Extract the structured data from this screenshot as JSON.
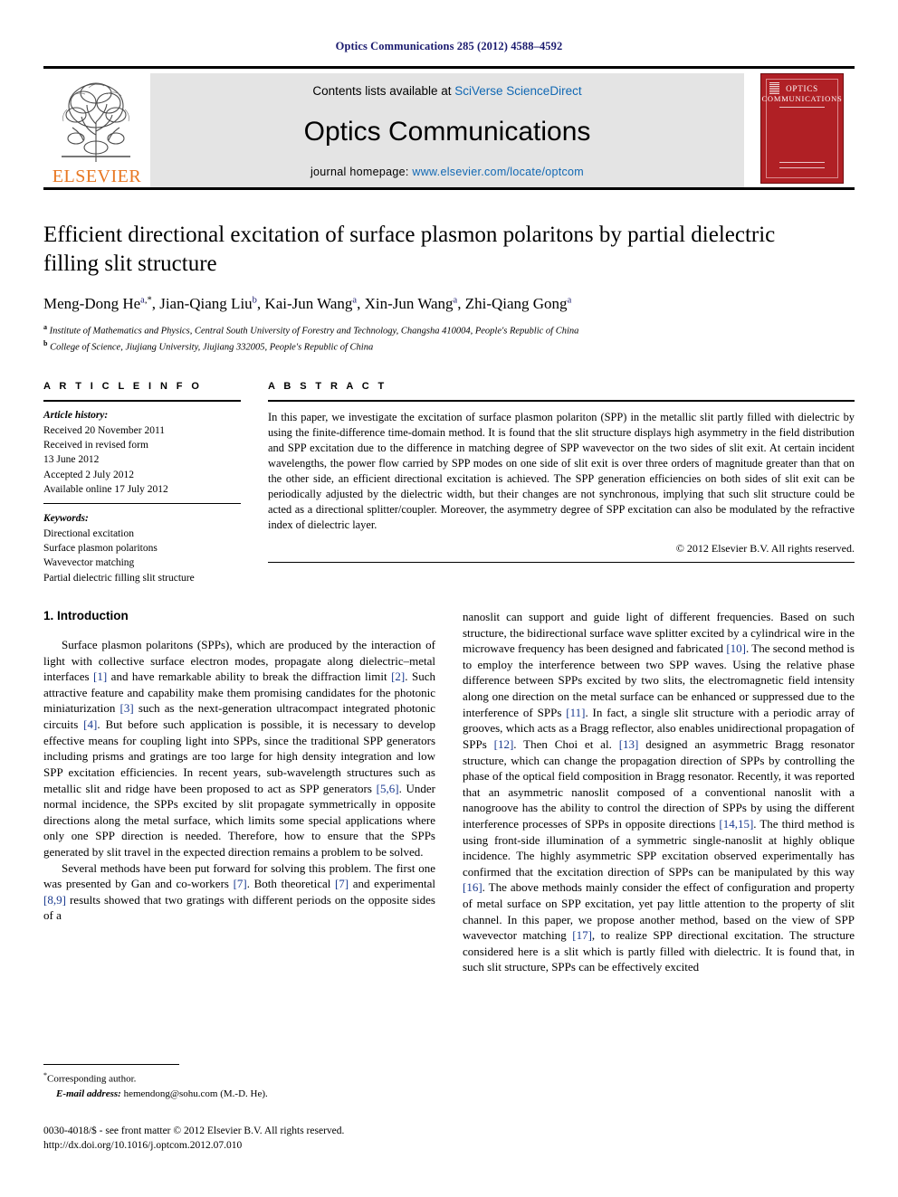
{
  "running_head": "Optics Communications 285 (2012) 4588–4592",
  "banner": {
    "contents_prefix": "Contents lists available at ",
    "contents_link": "SciVerse ScienceDirect",
    "journal_title": "Optics Communications",
    "homepage_prefix": "journal homepage: ",
    "homepage_link": "www.elsevier.com/locate/optcom",
    "publisher_name": "ELSEVIER",
    "cover": {
      "line1": "OPTICS",
      "line2": "COMMUNICATIONS"
    }
  },
  "title": "Efficient directional excitation of surface plasmon polaritons by partial dielectric filling slit structure",
  "authors": [
    {
      "name": "Meng-Dong He",
      "sup": "a",
      "star": true
    },
    {
      "name": "Jian-Qiang Liu",
      "sup": "b",
      "star": false
    },
    {
      "name": "Kai-Jun Wang",
      "sup": "a",
      "star": false
    },
    {
      "name": "Xin-Jun Wang",
      "sup": "a",
      "star": false
    },
    {
      "name": "Zhi-Qiang Gong",
      "sup": "a",
      "star": false
    }
  ],
  "affiliations": [
    {
      "marker": "a",
      "text": "Institute of Mathematics and Physics, Central South University of Forestry and Technology, Changsha 410004, People's Republic of China"
    },
    {
      "marker": "b",
      "text": "College of Science, Jiujiang University, Jiujiang 332005, People's Republic of China"
    }
  ],
  "article_info": {
    "heading": "A R T I C L E   I N F O",
    "history_label": "Article history:",
    "history": [
      "Received 20 November 2011",
      "Received in revised form",
      "13 June 2012",
      "Accepted 2 July 2012",
      "Available online 17 July 2012"
    ],
    "keywords_label": "Keywords:",
    "keywords": [
      "Directional excitation",
      "Surface plasmon polaritons",
      "Wavevector matching",
      "Partial dielectric filling slit structure"
    ]
  },
  "abstract": {
    "heading": "A B S T R A C T",
    "text": "In this paper, we investigate the excitation of surface plasmon polariton (SPP) in the metallic slit partly filled with dielectric by using the finite-difference time-domain method. It is found that the slit structure displays high asymmetry in the field distribution and SPP excitation due to the difference in matching degree of SPP wavevector on the two sides of slit exit. At certain incident wavelengths, the power flow carried by SPP modes on one side of slit exit is over three orders of magnitude greater than that on the other side, an efficient directional excitation is achieved. The SPP generation efficiencies on both sides of slit exit can be periodically adjusted by the dielectric width, but their changes are not synchronous, implying that such slit structure could be acted as a directional splitter/coupler. Moreover, the asymmetry degree of SPP excitation can also be modulated by the refractive index of dielectric layer.",
    "copyright": "© 2012 Elsevier B.V. All rights reserved."
  },
  "body": {
    "section_title": "1.  Introduction",
    "left_paragraphs": [
      "Surface plasmon polaritons (SPPs), which are produced by the interaction of light with collective surface electron modes, propagate along dielectric–metal interfaces [1] and have remarkable ability to break the diffraction limit [2]. Such attractive feature and capability make them promising candidates for the photonic miniaturization [3] such as the next-generation ultracompact integrated photonic circuits [4]. But before such application is possible, it is necessary to develop effective means for coupling light into SPPs, since the traditional SPP generators including prisms and gratings are too large for high density integration and low SPP excitation efficiencies. In recent years, sub-wavelength structures such as metallic slit and ridge have been proposed to act as SPP generators [5,6]. Under normal incidence, the SPPs excited by slit propagate symmetrically in opposite directions along the metal surface, which limits some special applications where only one SPP direction is needed. Therefore, how to ensure that the SPPs generated by slit travel in the expected direction remains a problem to be solved.",
      "Several methods have been put forward for solving this problem. The first one was presented by Gan and co-workers [7]. Both theoretical [7] and experimental [8,9] results showed that two gratings with different periods on the opposite sides of a"
    ],
    "right_paragraphs": [
      "nanoslit can support and guide light of different frequencies. Based on such structure, the bidirectional surface wave splitter excited by a cylindrical wire in the microwave frequency has been designed and fabricated [10]. The second method is to employ the interference between two SPP waves. Using the relative phase difference between SPPs excited by two slits, the electromagnetic field intensity along one direction on the metal surface can be enhanced or suppressed due to the interference of SPPs [11]. In fact, a single slit structure with a periodic array of grooves, which acts as a Bragg reflector, also enables unidirectional propagation of SPPs [12]. Then Choi et al. [13] designed an asymmetric Bragg resonator structure, which can change the propagation direction of SPPs by controlling the phase of the optical field composition in Bragg resonator. Recently, it was reported that an asymmetric nanoslit composed of a conventional nanoslit with a nanogroove has the ability to control the direction of SPPs by using the different interference processes of SPPs in opposite directions [14,15]. The third method is using front-side illumination of a symmetric single-nanoslit at highly oblique incidence. The highly asymmetric SPP excitation observed experimentally has confirmed that the excitation direction of SPPs can be manipulated by this way [16]. The above methods mainly consider the effect of configuration and property of metal surface on SPP excitation, yet pay little attention to the property of slit channel. In this paper, we propose another method, based on the view of SPP wavevector matching [17], to realize SPP directional excitation. The structure considered here is a slit which is partly filled with dielectric. It is found that, in such slit structure, SPPs can be effectively excited"
    ]
  },
  "footnotes": {
    "corresponding": "Corresponding author.",
    "email_label": "E-mail address:",
    "email": "hemendong@sohu.com (M.-D. He)."
  },
  "footer": {
    "issn_line": "0030-4018/$ - see front matter © 2012 Elsevier B.V. All rights reserved.",
    "doi_line": "http://dx.doi.org/10.1016/j.optcom.2012.07.010"
  },
  "colors": {
    "running_head": "#1a1a6e",
    "link": "#1168b3",
    "reference": "#1a3a8f",
    "elsevier_orange": "#E87722",
    "cover_red": "#b02025",
    "banner_gray": "#e4e4e4"
  }
}
